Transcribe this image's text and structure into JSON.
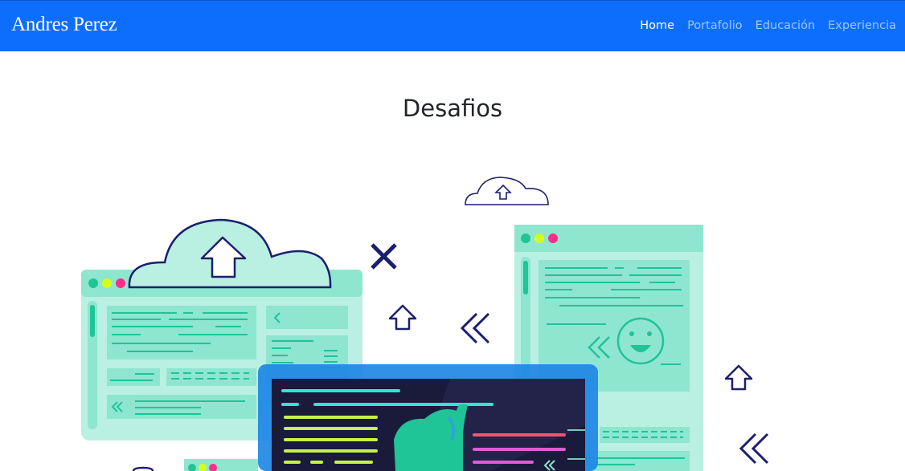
{
  "navbar": {
    "brand": "Andres Perez",
    "links": [
      {
        "label": "Home",
        "active": true
      },
      {
        "label": "Portafolio",
        "active": false
      },
      {
        "label": "Educación",
        "active": false
      },
      {
        "label": "Experiencia",
        "active": false
      }
    ]
  },
  "main": {
    "title": "Desafios"
  },
  "colors": {
    "navbar": "#0d6efd",
    "mint": "#8ee6cf",
    "mint_light": "#b9f0e1",
    "navy": "#1b1f6e",
    "screen": "#1a1a3a"
  }
}
